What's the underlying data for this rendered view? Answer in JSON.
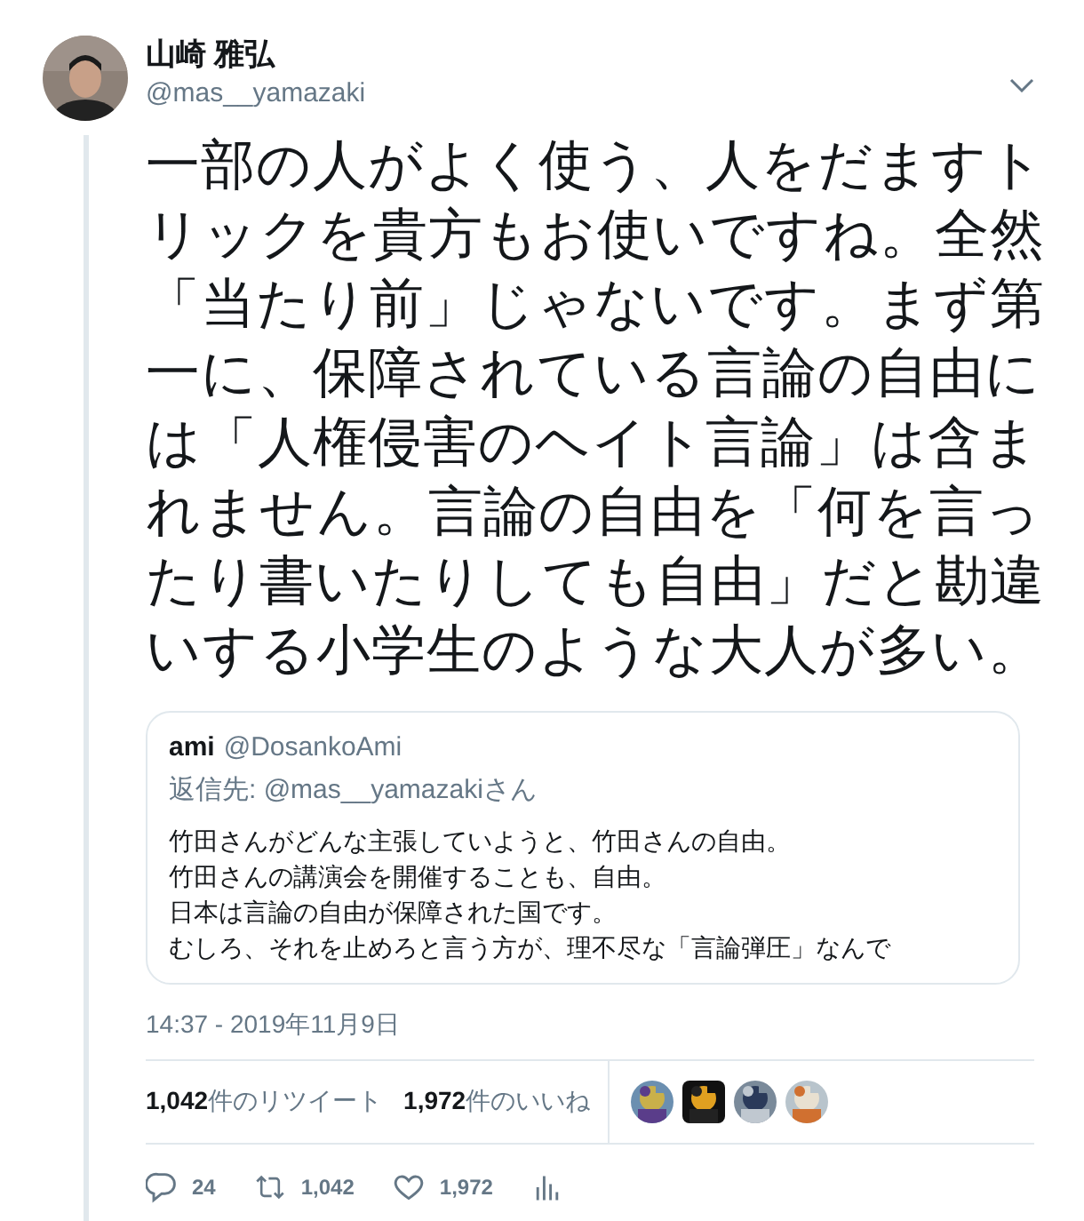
{
  "author": {
    "name": "山崎 雅弘",
    "handle": "@mas__yamazaki"
  },
  "text": "一部の人がよく使う、人をだますトリックを貴方もお使いですね。全然「当たり前」じゃないです。まず第一に、保障されている言論の自由には「人権侵害のヘイト言論」は含まれません。言論の自由を「何を言ったり書いたりしても自由」だと勘違いする小学生のような大人が多い。",
  "quote": {
    "name": "ami",
    "handle": "@DosankoAmi",
    "reply_to": "返信先: @mas__yamazakiさん",
    "lines": [
      "竹田さんがどんな主張していようと、竹田さんの自由。",
      "竹田さんの講演会を開催することも、自由。",
      "日本は言論の自由が保障された国です。",
      "むしろ、それを止めろと言う方が、理不尽な「言論弾圧」なんで"
    ]
  },
  "timestamp": "14:37 - 2019年11月9日",
  "stats": [
    {
      "count": "1,042",
      "label": "件のリツイート"
    },
    {
      "count": "1,972",
      "label": "件のいいね"
    }
  ],
  "actions": [
    {
      "kind": "reply",
      "count": "24"
    },
    {
      "kind": "retweet",
      "count": "1,042"
    },
    {
      "kind": "like",
      "count": "1,972"
    },
    {
      "kind": "analytics"
    }
  ]
}
